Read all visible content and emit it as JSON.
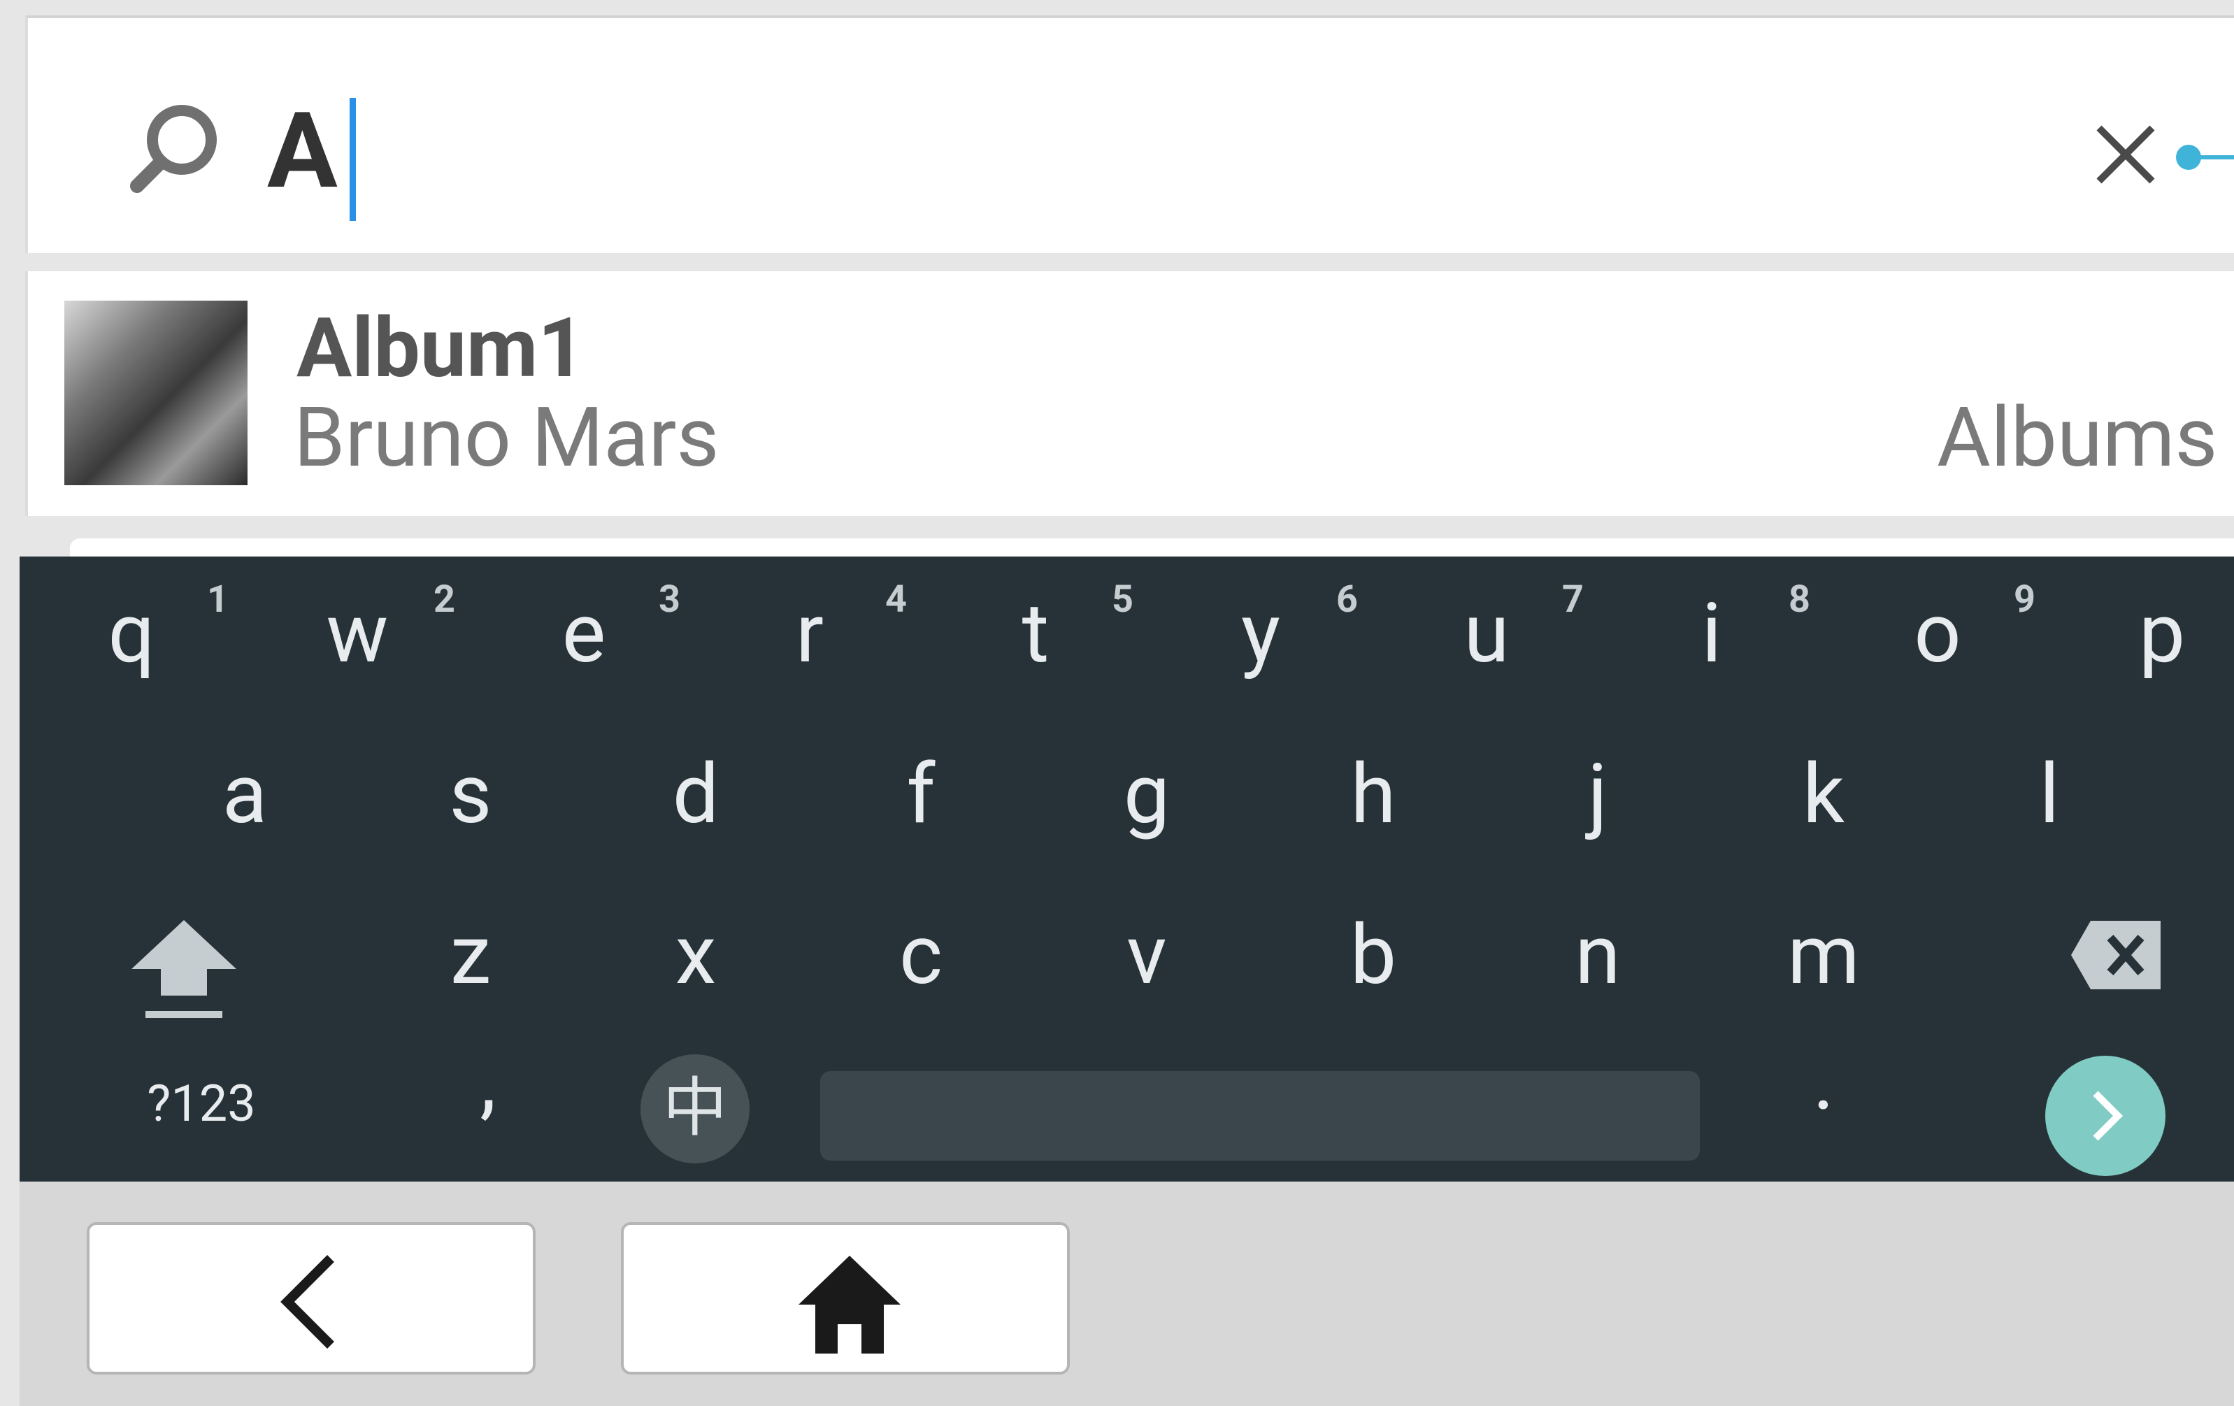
{
  "search": {
    "query": "A",
    "icons": {
      "search": "search-icon",
      "clear": "close-icon"
    },
    "accent_color": "#3fb3d8"
  },
  "results": [
    {
      "title": "Album1",
      "artist": "Bruno Mars",
      "category": "Albums",
      "thumbnail": "album-art"
    }
  ],
  "keyboard": {
    "rows": [
      [
        "q",
        "w",
        "e",
        "r",
        "t",
        "y",
        "u",
        "i",
        "o",
        "p"
      ],
      [
        "a",
        "s",
        "d",
        "f",
        "g",
        "h",
        "j",
        "k",
        "l"
      ],
      [
        "z",
        "x",
        "c",
        "v",
        "b",
        "n",
        "m"
      ]
    ],
    "numbers": [
      "1",
      "2",
      "3",
      "4",
      "5",
      "6",
      "7",
      "8",
      "9"
    ],
    "symbols_label": "?123",
    "comma": ",",
    "period": ".",
    "language_label": "中",
    "icons": {
      "shift": "shift-icon",
      "backspace": "backspace-icon",
      "enter": "chevron-right-icon"
    },
    "background_color": "#263238",
    "enter_color": "#80cbc4"
  },
  "navigation": {
    "icons": {
      "back": "back-arrow-icon",
      "home": "home-icon"
    }
  }
}
